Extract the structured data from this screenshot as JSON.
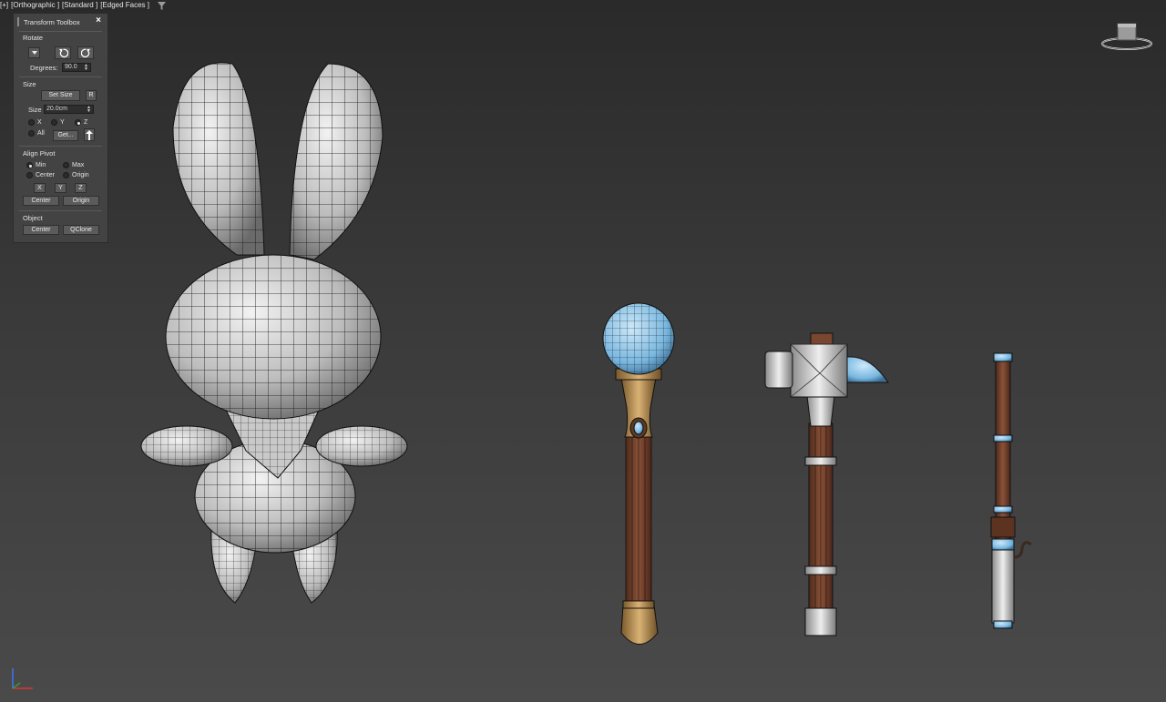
{
  "viewport": {
    "labels": [
      "[+]",
      "[Orthographic ]",
      "[Standard ]",
      "[Edged Faces ]"
    ],
    "filter_icon": "funnel-icon"
  },
  "toolbox": {
    "title": "Transform Toolbox",
    "close_glyph": "×",
    "rotate": {
      "heading": "Rotate",
      "degrees_label": "Degrees:",
      "degrees_value": "90.0"
    },
    "size": {
      "heading": "Size",
      "set_size_label": "Set Size",
      "r_label": "R",
      "size_label": "Size",
      "size_value": "20.0cm",
      "axes": [
        {
          "label": "X",
          "selected": false
        },
        {
          "label": "Y",
          "selected": false
        },
        {
          "label": "Z",
          "selected": true
        }
      ],
      "all_label": "All",
      "get_label": "Get..."
    },
    "align_pivot": {
      "heading": "Align Pivot",
      "options": [
        {
          "label": "Min",
          "selected": true
        },
        {
          "label": "Max",
          "selected": false
        },
        {
          "label": "Center",
          "selected": false
        },
        {
          "label": "Origin",
          "selected": false
        }
      ],
      "axis_buttons": [
        "X",
        "Y",
        "Z"
      ],
      "center_label": "Center",
      "origin_label": "Origin"
    },
    "object": {
      "heading": "Object",
      "center_label": "Center",
      "qclone_label": "QClone"
    }
  },
  "scene": {
    "objects": [
      "bunny",
      "staff",
      "hammer",
      "rod"
    ]
  },
  "colors": {
    "mesh_gray": "#d4d4d4",
    "wood": "#7a4630",
    "gold": "#c19a5b",
    "crystal": "#8fc8ec",
    "wire": "#111111"
  }
}
